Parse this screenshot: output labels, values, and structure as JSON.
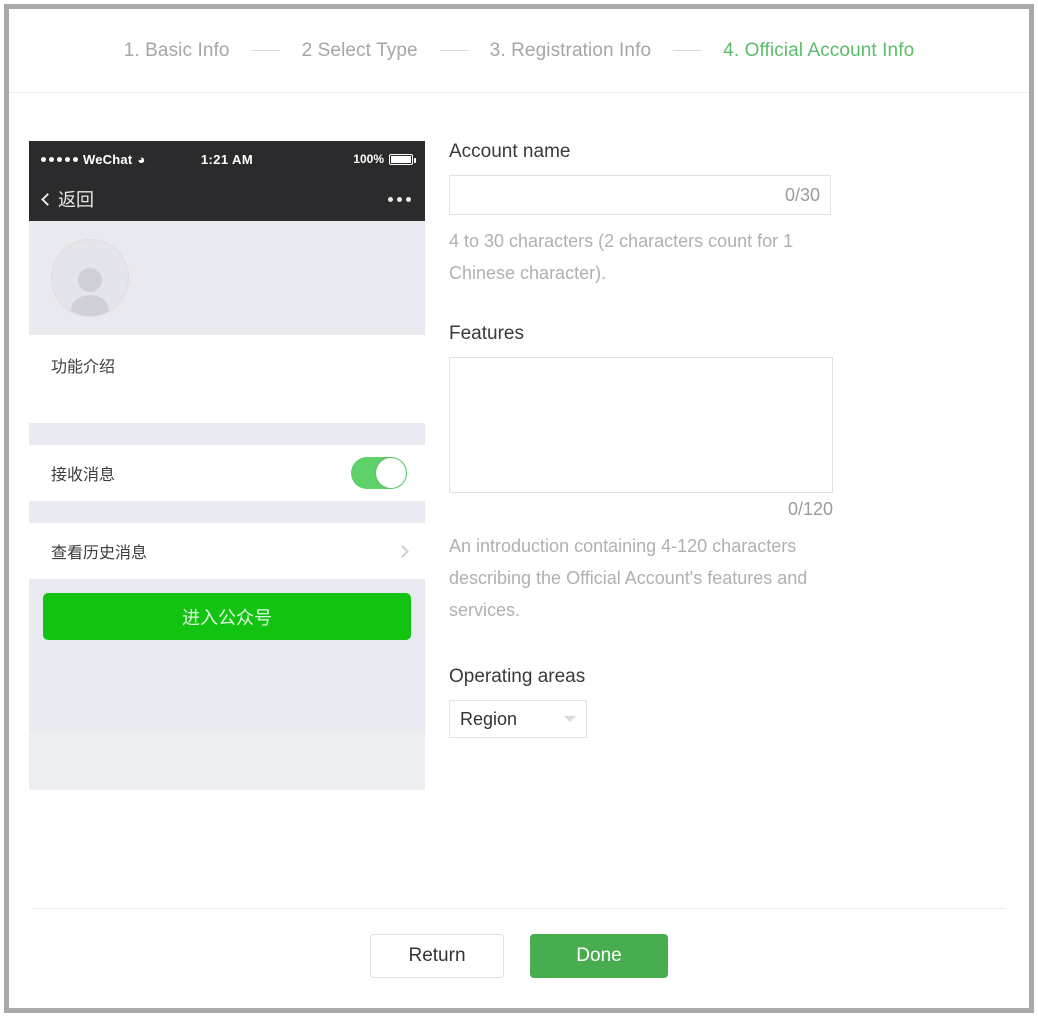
{
  "steps": [
    {
      "label": "1. Basic Info",
      "active": false
    },
    {
      "label": "2 Select Type",
      "active": false
    },
    {
      "label": "3. Registration Info",
      "active": false
    },
    {
      "label": "4. Official Account Info",
      "active": true
    }
  ],
  "phone_preview": {
    "status_bar": {
      "carrier": "WeChat",
      "wifi_icon": "wifi-icon",
      "time": "1:21 AM",
      "battery_percent": "100%"
    },
    "nav_bar": {
      "back_label": "返回",
      "more_icon": "more-dots-icon"
    },
    "avatar_icon": "person-avatar-icon",
    "intro_label": "功能介绍",
    "receive_messages_label": "接收消息",
    "receive_messages_on": true,
    "history_label": "查看历史消息",
    "history_chevron_icon": "chevron-right-icon",
    "cta_label": "进入公众号"
  },
  "form": {
    "account_name": {
      "label": "Account name",
      "value": "",
      "counter": "0/30",
      "hint": "4 to 30 characters (2 characters count for 1 Chinese character)."
    },
    "features": {
      "label": "Features",
      "value": "",
      "counter": "0/120",
      "hint": "An introduction containing 4-120 characters describing the Official Account's features and services."
    },
    "operating_areas": {
      "label": "Operating areas",
      "selected": "Region",
      "caret_icon": "caret-down-icon"
    }
  },
  "footer": {
    "return_label": "Return",
    "done_label": "Done"
  },
  "colors": {
    "active_step_green": "#5bbd6a",
    "cta_green": "#13c312",
    "primary_green": "#48ad4f",
    "toggle_green": "#5ed16a",
    "muted_text": "#b0b0b0"
  }
}
